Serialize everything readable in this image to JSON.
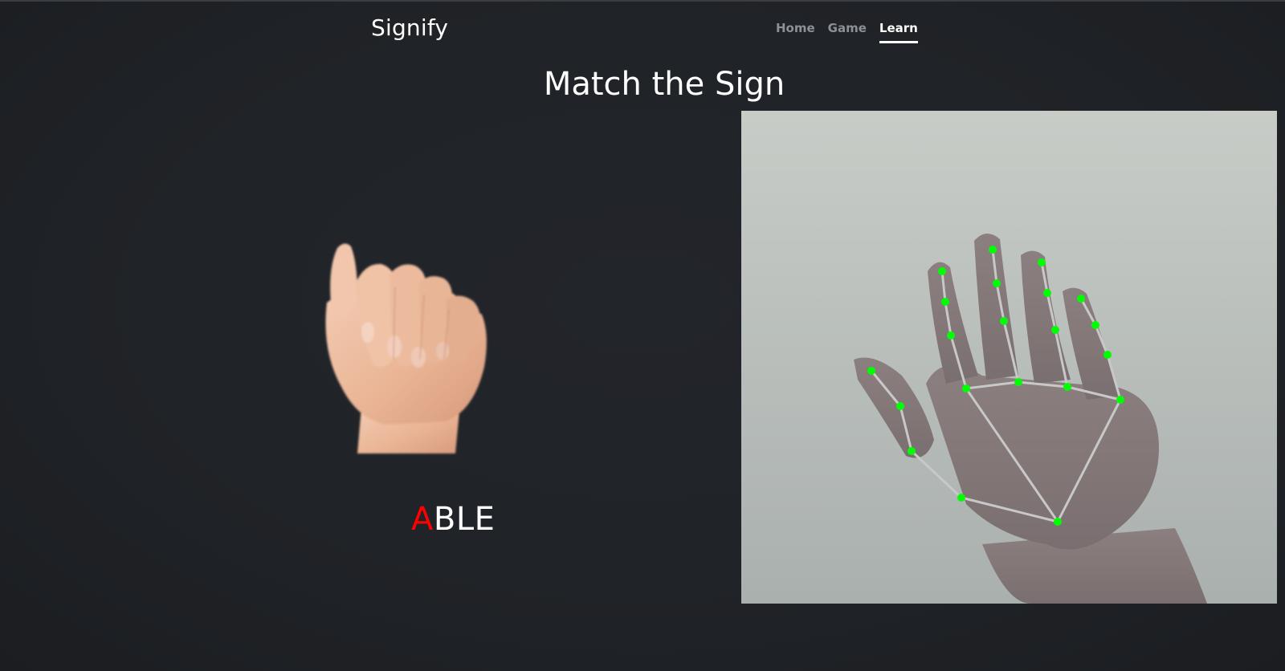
{
  "brand": "Signify",
  "nav": {
    "items": [
      {
        "label": "Home",
        "active": false
      },
      {
        "label": "Game",
        "active": false
      },
      {
        "label": "Learn",
        "active": true
      }
    ]
  },
  "title": "Match the Sign",
  "target": {
    "sign_image": "asl-letter-a-hand-image",
    "word_highlight": "A",
    "word_rest": "BLE",
    "highlight_color": "#ff0000"
  },
  "camera": {
    "feed": "webcam-feed-with-hand-landmarks",
    "landmark_color": "#00ff00",
    "connection_color": "#c8c8c8"
  }
}
